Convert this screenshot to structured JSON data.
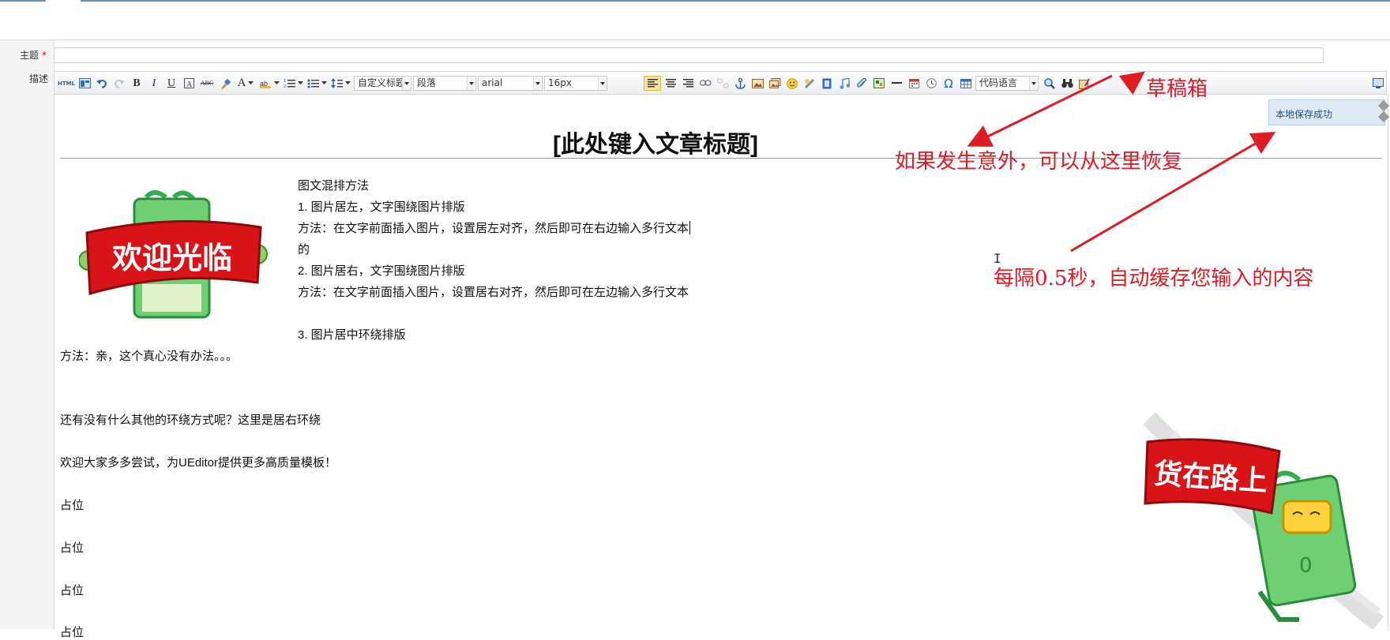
{
  "form": {
    "subject_label": "主题",
    "required_mark": "*",
    "subject_value": "",
    "description_label": "描述"
  },
  "toolbar": {
    "source_label": "HTML",
    "custom_title_select": "自定义标题",
    "paragraph_select": "段落",
    "font_family_select": "arial",
    "font_size_select": "16px",
    "code_language_select": "代码语言",
    "omega_glyph": "Ω",
    "bold": "B",
    "italic": "I",
    "underline": "U",
    "font_color": "A",
    "strike": "ABC"
  },
  "content": {
    "title": "[此处键入文章标题]",
    "lines_right": [
      "图文混排方法",
      "1. 图片居左，文字围绕图片排版",
      "方法：在文字前面插入图片，设置居左对齐，然后即可在右边输入多行文本",
      "的",
      "2. 图片居右，文字围绕图片排版",
      "方法：在文字前面插入图片，设置居右对齐，然后即可在左边输入多行文本",
      "3. 图片居中环绕排版"
    ],
    "lines_full": [
      "方法：亲，这个真心没有办法。。。",
      "还有没有什么其他的环绕方式呢？这里是居右环绕",
      "欢迎大家多多尝试，为UEditor提供更多高质量模板！",
      "占位",
      "占位",
      "占位",
      "占位"
    ],
    "image_left_text": "欢迎光临",
    "image_right_text": "货在路上"
  },
  "annotations": {
    "drafts": "草稿箱",
    "recover": "如果发生意外，可以从这里恢复",
    "autosave": "每隔0.5秒，自动缓存您输入的内容"
  },
  "toast": {
    "message": "本地保存成功"
  },
  "colors": {
    "annotation": "#e01b24",
    "toolbar_bg": "#eceff3",
    "toast_bg": "#dde9f5",
    "banner_red": "#d81419",
    "bag_green": "#2fae4f"
  }
}
